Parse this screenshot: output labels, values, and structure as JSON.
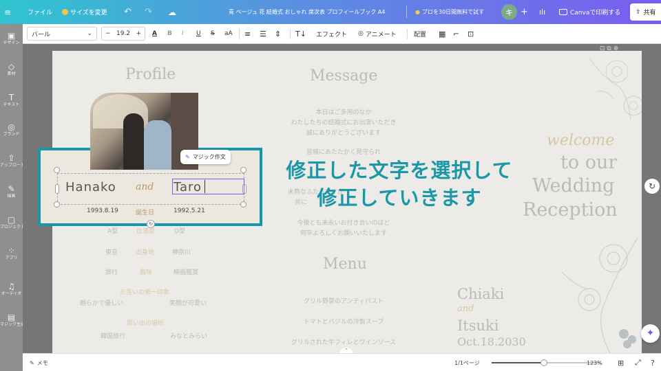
{
  "topbar": {
    "menu_icon": "≡",
    "file": "ファイル",
    "resize": "サイズを変更",
    "undo_icon": "↶",
    "redo_icon": "↷",
    "cloud_icon": "☁",
    "doc_title": "青 ベージュ 花 結婚式 おしゃれ 席次表 プロフィールブック A4",
    "trial": "プロを30日間無料で試す",
    "avatar": "キ",
    "plus": "+",
    "stats_icon": "ılı",
    "print": "Canvaで印刷する",
    "share": "共有"
  },
  "sidebar": {
    "items": [
      {
        "icon": "▣",
        "label": "デザイン"
      },
      {
        "icon": "◇",
        "label": "素材"
      },
      {
        "icon": "T",
        "label": "テキスト"
      },
      {
        "icon": "◎",
        "label": "ブランド"
      },
      {
        "icon": "⇧",
        "label": "アップロード"
      },
      {
        "icon": "✎",
        "label": "描画"
      },
      {
        "icon": "▢",
        "label": "プロジェクト"
      },
      {
        "icon": "⁘",
        "label": "アプリ"
      },
      {
        "icon": "♫",
        "label": "オーディオ"
      },
      {
        "icon": "▤",
        "label": "マジック生成"
      }
    ]
  },
  "toolbar": {
    "font": "バール",
    "font_size": "19.2",
    "minus": "−",
    "plus": "+",
    "color_icon": "A",
    "bold": "B",
    "italic": "I",
    "underline": "U",
    "strike": "S",
    "case": "aA",
    "effects": "エフェクト",
    "animate": "アニメート",
    "position": "配置"
  },
  "page": {
    "profile_title": "Profile",
    "message_title": "Message",
    "menu_title": "Menu",
    "message_lines": [
      "本日はご多用のなか",
      "わたしたちの結婚式にお出席いただき",
      "誠にありがとうございます",
      "皆様にあたたかく見守られ",
      "未熟なふたりですが",
      "共に",
      "今後とも末永いお付き合いのほど",
      "何卒よろしくお願いいたします"
    ],
    "profile_rows": [
      {
        "left": "A型",
        "mid": "血液型",
        "right": "O型"
      },
      {
        "left": "東京",
        "mid": "出身地",
        "right": "神奈川"
      },
      {
        "left": "旅行",
        "mid": "趣味",
        "right": "映画鑑賞"
      }
    ],
    "first_impression_label": "お互いの第一印象",
    "first_impression_left": "朗らかで優しい",
    "first_impression_right": "笑顔が可愛い",
    "memory_label": "思い出の場所",
    "memory_left": "韓国旅行",
    "memory_right": "みなとみらい",
    "menu_items": [
      "グリル野菜のアンティパスト",
      "トマトとバジルの冷製スープ",
      "グリルされた牛フィレとワインソース"
    ],
    "welcome": "welcome",
    "to_our": "to our",
    "wedding": "Wedding",
    "reception": "Reception",
    "chiaki": "Chiaki",
    "and_small": "and",
    "itsuki": "Itsuki",
    "date": "Oct.18.2030"
  },
  "edit": {
    "hanako": "Hanako",
    "and": "and",
    "taro": "Taro",
    "date_left": "1993.8.19",
    "birthday": "誕生日",
    "date_right": "1992.5.21",
    "magic_write": "マジック作文"
  },
  "overlay": {
    "line1": "修正した文字を選択して",
    "line2": "修正していきます"
  },
  "bottombar": {
    "notes": "メモ",
    "pages": "1/1ページ",
    "zoom": "123%",
    "zoom_level": 0.48
  }
}
